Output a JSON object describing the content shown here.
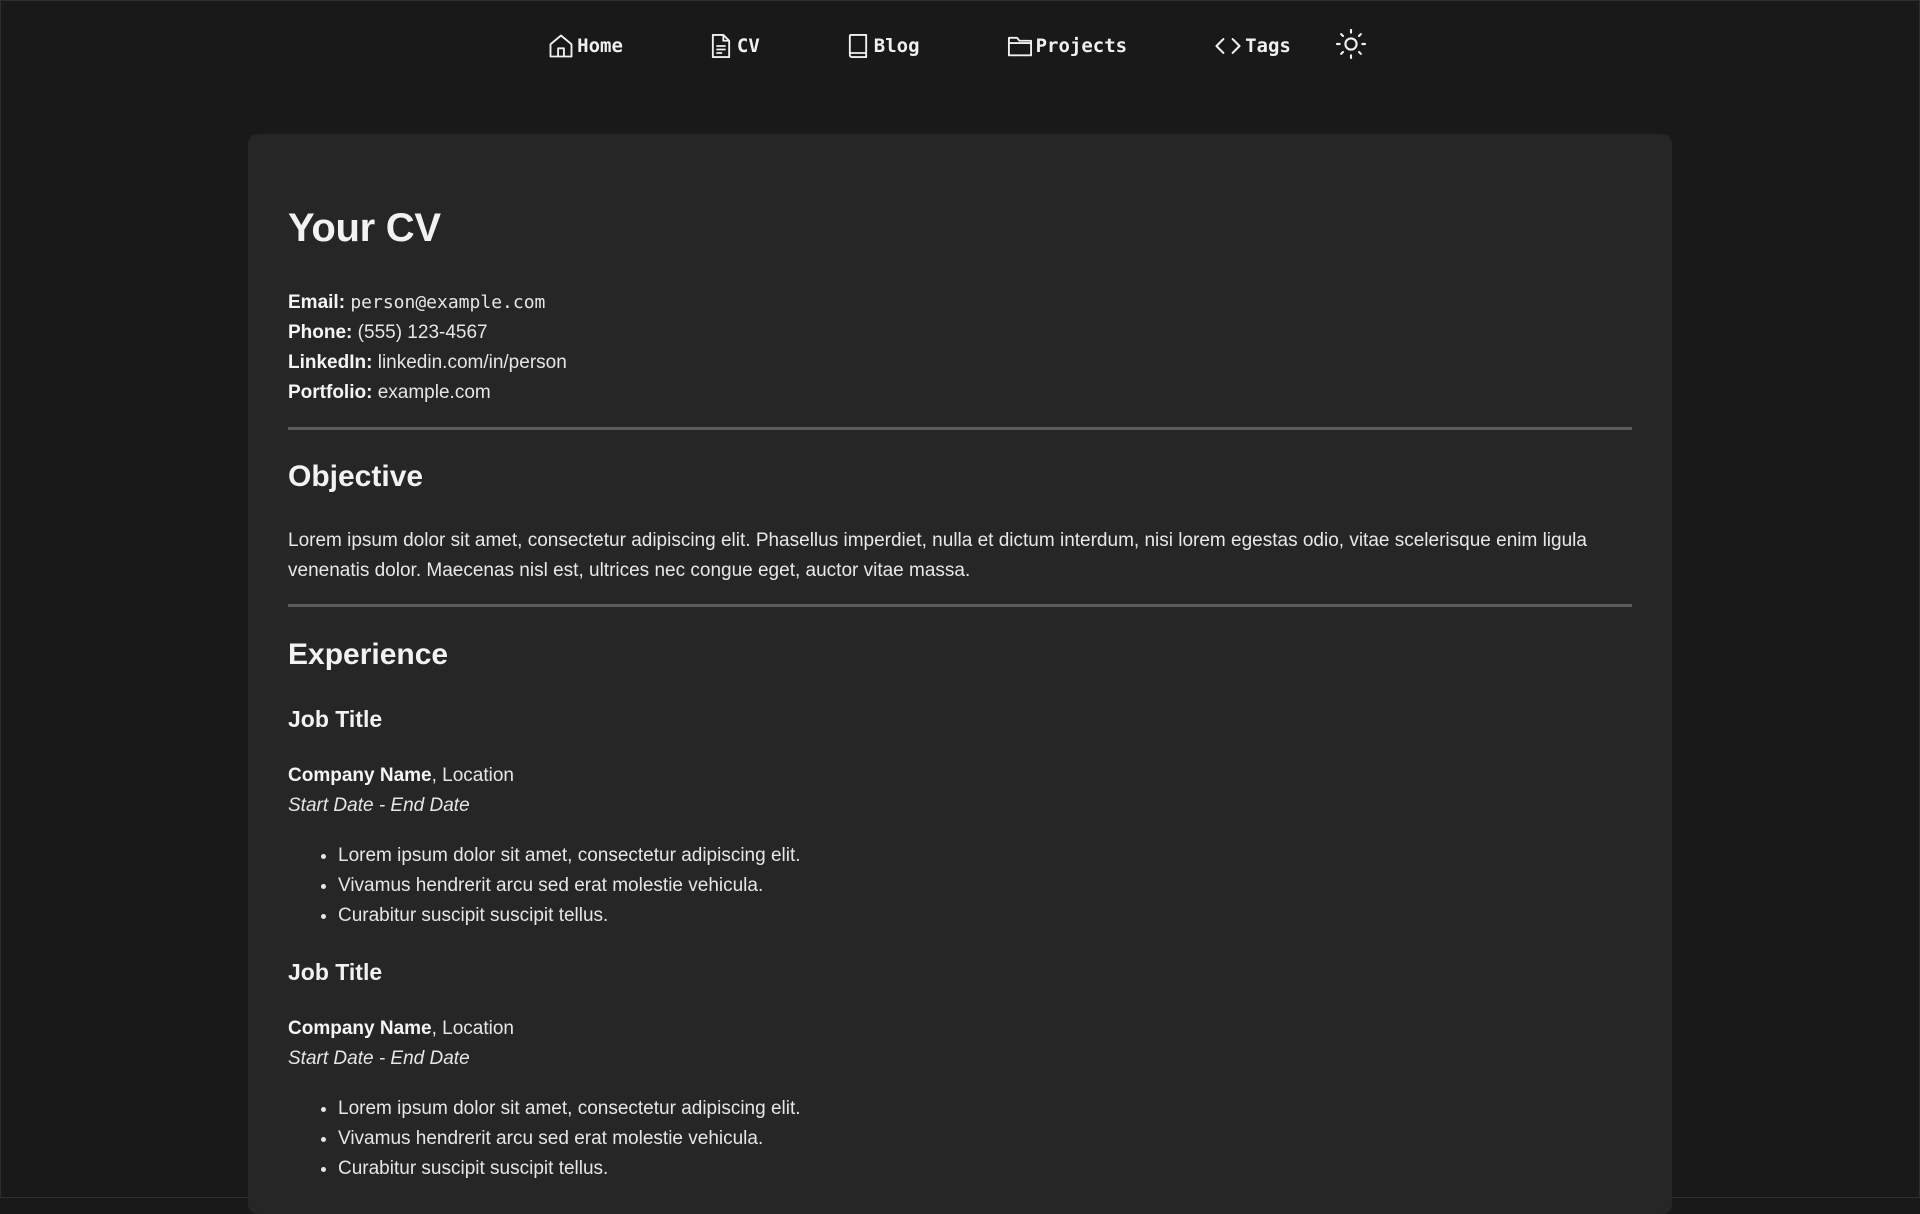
{
  "nav": {
    "items": [
      {
        "label": "Home",
        "icon": "home-icon"
      },
      {
        "label": "CV",
        "icon": "document-icon"
      },
      {
        "label": "Blog",
        "icon": "book-icon"
      },
      {
        "label": "Projects",
        "icon": "folder-icon"
      },
      {
        "label": "Tags",
        "icon": "code-icon"
      }
    ],
    "theme_toggle_icon": "sun-icon"
  },
  "cv": {
    "title": "Your CV",
    "contact": {
      "email_label": "Email:",
      "email_value": "person@example.com",
      "phone_label": "Phone:",
      "phone_value": "(555) 123-4567",
      "linkedin_label": "LinkedIn:",
      "linkedin_value": "linkedin.com/in/person",
      "portfolio_label": "Portfolio:",
      "portfolio_value": "example.com"
    },
    "objective": {
      "heading": "Objective",
      "text": "Lorem ipsum dolor sit amet, consectetur adipiscing elit. Phasellus imperdiet, nulla et dictum interdum, nisi lorem egestas odio, vitae scelerisque enim ligula venenatis dolor. Maecenas nisl est, ultrices nec congue eget, auctor vitae massa."
    },
    "experience": {
      "heading": "Experience",
      "jobs": [
        {
          "title": "Job Title",
          "company": "Company Name",
          "location": ", Location",
          "dates": "Start Date - End Date",
          "bullets": [
            "Lorem ipsum dolor sit amet, consectetur adipiscing elit.",
            "Vivamus hendrerit arcu sed erat molestie vehicula.",
            "Curabitur suscipit suscipit tellus."
          ]
        },
        {
          "title": "Job Title",
          "company": "Company Name",
          "location": ", Location",
          "dates": "Start Date - End Date",
          "bullets": [
            "Lorem ipsum dolor sit amet, consectetur adipiscing elit.",
            "Vivamus hendrerit arcu sed erat molestie vehicula.",
            "Curabitur suscipit suscipit tellus."
          ]
        }
      ]
    }
  },
  "colors": {
    "page_background": "#191919",
    "card_background": "#262626",
    "divider": "#5b5b5b",
    "text": "#e6e6e6"
  }
}
